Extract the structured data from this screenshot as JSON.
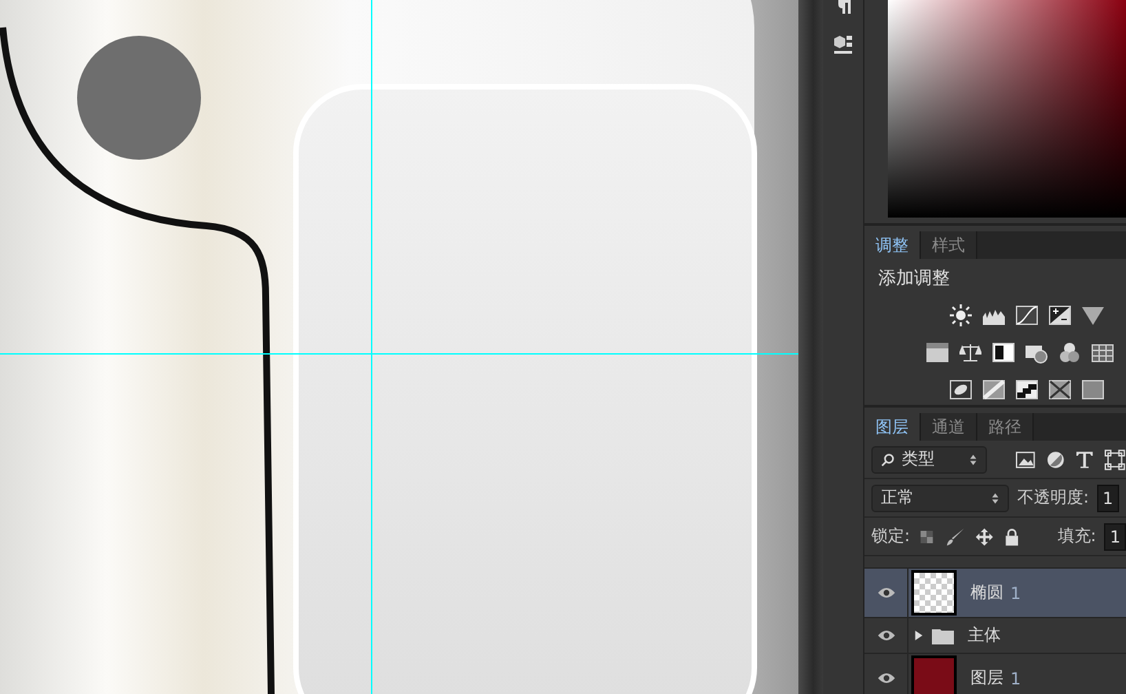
{
  "adjust_panel": {
    "tabs": [
      {
        "label": "调整",
        "selected": true
      },
      {
        "label": "样式",
        "selected": false
      }
    ],
    "heading": "添加调整"
  },
  "layers_panel": {
    "tabs": [
      {
        "label": "图层",
        "selected": true
      },
      {
        "label": "通道",
        "selected": false
      },
      {
        "label": "路径",
        "selected": false
      }
    ],
    "filter": {
      "value": "类型"
    },
    "blend_mode": {
      "value": "正常"
    },
    "opacity": {
      "label": "不透明度:",
      "value": "1"
    },
    "lock_label": "锁定:",
    "fill": {
      "label": "填充:",
      "value": "1"
    },
    "layers": [
      {
        "kind": "shape",
        "name": "椭圆",
        "number": "1",
        "selected": true,
        "visible": true
      },
      {
        "kind": "group",
        "name": "主体",
        "selected": false,
        "visible": true,
        "expanded": false
      },
      {
        "kind": "fill",
        "name": "图层",
        "number": "1",
        "selected": false,
        "visible": true,
        "color": "#7a0c17"
      }
    ]
  }
}
